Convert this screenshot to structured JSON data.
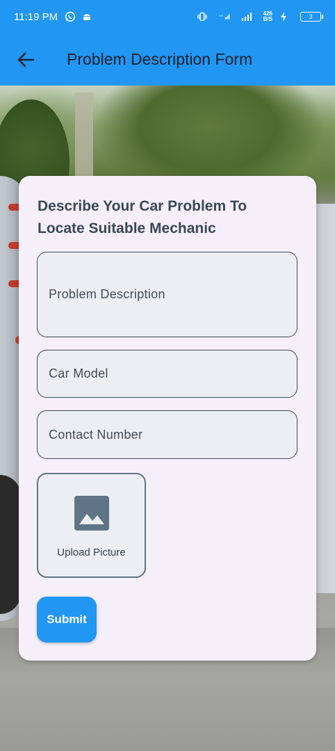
{
  "status_bar": {
    "time": "11:19 PM",
    "icons": [
      "whatsapp-icon",
      "android-icon"
    ],
    "network_speed": "426\nB/S",
    "battery_level": "3"
  },
  "app_bar": {
    "back_icon": "arrow-left-icon",
    "title": "Problem Description Form"
  },
  "form": {
    "heading": "Describe Your Car Problem To Locate Suitable Mechanic",
    "problem_description_placeholder": "Problem Description",
    "car_model_placeholder": "Car Model",
    "contact_number_placeholder": "Contact Number",
    "upload_icon": "image-icon",
    "upload_label": "Upload Picture",
    "submit_label": "Submit"
  },
  "colors": {
    "primary": "#2196f3",
    "card_background": "#f5eff9",
    "field_background": "#eceef3",
    "upload_icon": "#5e7585"
  }
}
